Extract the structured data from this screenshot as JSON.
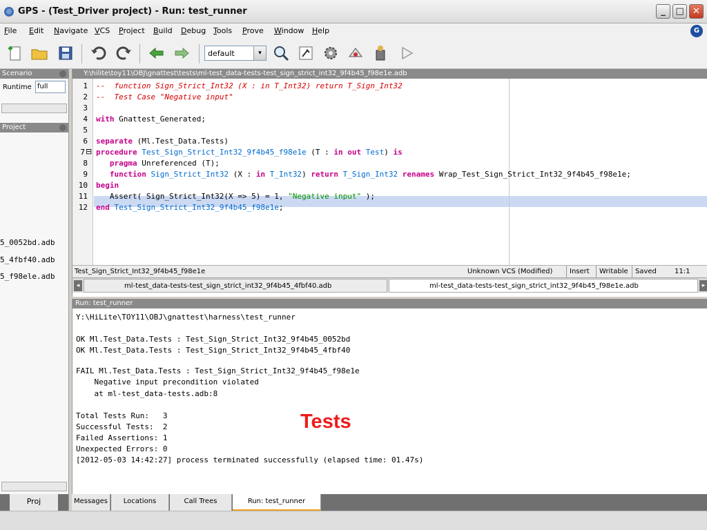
{
  "window": {
    "title": "GPS - (Test_Driver project) - Run: test_runner",
    "app_icon": "gps-icon",
    "badge": "G"
  },
  "menu": [
    "File",
    "Edit",
    "Navigate",
    "VCS",
    "Project",
    "Build",
    "Debug",
    "Tools",
    "Prove",
    "Window",
    "Help"
  ],
  "toolbar": {
    "combo_value": "default",
    "combo_arrow": "▾"
  },
  "left": {
    "scenario_title": "Scenario",
    "runtime_label": "Runtime",
    "runtime_value": "full",
    "project_title": "Project",
    "files": [
      "5_0052bd.adb",
      "5_4fbf40.adb",
      "5_f98ele.adb"
    ],
    "tab_label": "Proj"
  },
  "editor": {
    "path": "Y:\\hilite\\toy11\\OBJ\\gnattest\\tests\\ml-test_data-tests-test_sign_strict_int32_9f4b45_f98e1e.adb",
    "line_numbers": [
      "1",
      "2",
      "3",
      "4",
      "5",
      "6",
      "7",
      "8",
      "9",
      "10",
      "11",
      "12"
    ],
    "fold_marker": "⊟",
    "status_name": "Test_Sign_Strict_Int32_9f4b45_f98e1e",
    "status_vcs": "Unknown VCS (Modified)",
    "status_mode": "Insert",
    "status_writable": "Writable",
    "status_saved": "Saved",
    "status_pos": "11:1",
    "tabs": [
      "ml-test_data-tests-test_sign_strict_int32_9f4b45_4fbf40.adb",
      "ml-test_data-tests-test_sign_strict_int32_9f4b45_f98e1e.adb"
    ]
  },
  "code": {
    "l1a": "--  ",
    "l1b": "function Sign_Strict_Int32 (X : in T_Int32) return T_Sign_Int32",
    "l2a": "--  ",
    "l2b": "Test Case \"Negative input\"",
    "l4a": "with",
    "l4b": " Gnattest_Generated;",
    "l6a": "separate",
    "l6b": " (Ml.Test_Data.Tests)",
    "l7a": "procedure",
    "l7b": " Test_Sign_Strict_Int32_9f4b45_f98e1e",
    "l7c": " (T : ",
    "l7d": "in out",
    "l7e": " Test",
    "l7f": ") ",
    "l7g": "is",
    "l8a": "   ",
    "l8b": "pragma",
    "l8c": " Unreferenced (T);",
    "l9a": "   ",
    "l9b": "function",
    "l9c": " Sign_Strict_Int32",
    "l9d": " (X : ",
    "l9e": "in",
    "l9f": " T_Int32",
    "l9g": ") ",
    "l9h": "return",
    "l9i": " T_Sign_Int32",
    "l9j": " renames",
    "l9k": " Wrap_Test_Sign_Strict_Int32_9f4b45_f98e1e;",
    "l10a": "begin",
    "l11a": "   Assert( Sign_Strict_Int32(X => 5) = 1, ",
    "l11b": "\"Negative input\"",
    "l11c": " );",
    "l12a": "end",
    "l12b": " Test_Sign_Strict_Int32_9f4b45_f98e1e",
    "l12c": ";"
  },
  "run": {
    "title": "Run: test_runner",
    "lines": [
      "Y:\\HiLite\\TOY11\\OBJ\\gnattest\\harness\\test_runner",
      "",
      "OK Ml.Test_Data.Tests : Test_Sign_Strict_Int32_9f4b45_0052bd",
      "OK Ml.Test_Data.Tests : Test_Sign_Strict_Int32_9f4b45_4fbf40",
      "",
      "FAIL Ml.Test_Data.Tests : Test_Sign_Strict_Int32_9f4b45_f98e1e",
      "    Negative input precondition violated",
      "    at ml-test_data-tests.adb:8",
      "",
      "Total Tests Run:   3",
      "Successful Tests:  2",
      "Failed Assertions: 1",
      "Unexpected Errors: 0",
      "[2012-05-03 14:42:27] process terminated successfully (elapsed time: 01.47s)"
    ],
    "overlay_label": "Tests"
  },
  "bottom_tabs": [
    "Messages",
    "Locations",
    "Call Trees",
    "Run: test_runner"
  ],
  "colors": {
    "keyword": "#c50089",
    "type": "#006ad0",
    "comment": "#d60000",
    "string": "#009000",
    "overlay": "#ee1c1c",
    "current_line": "#cbd9f3"
  }
}
